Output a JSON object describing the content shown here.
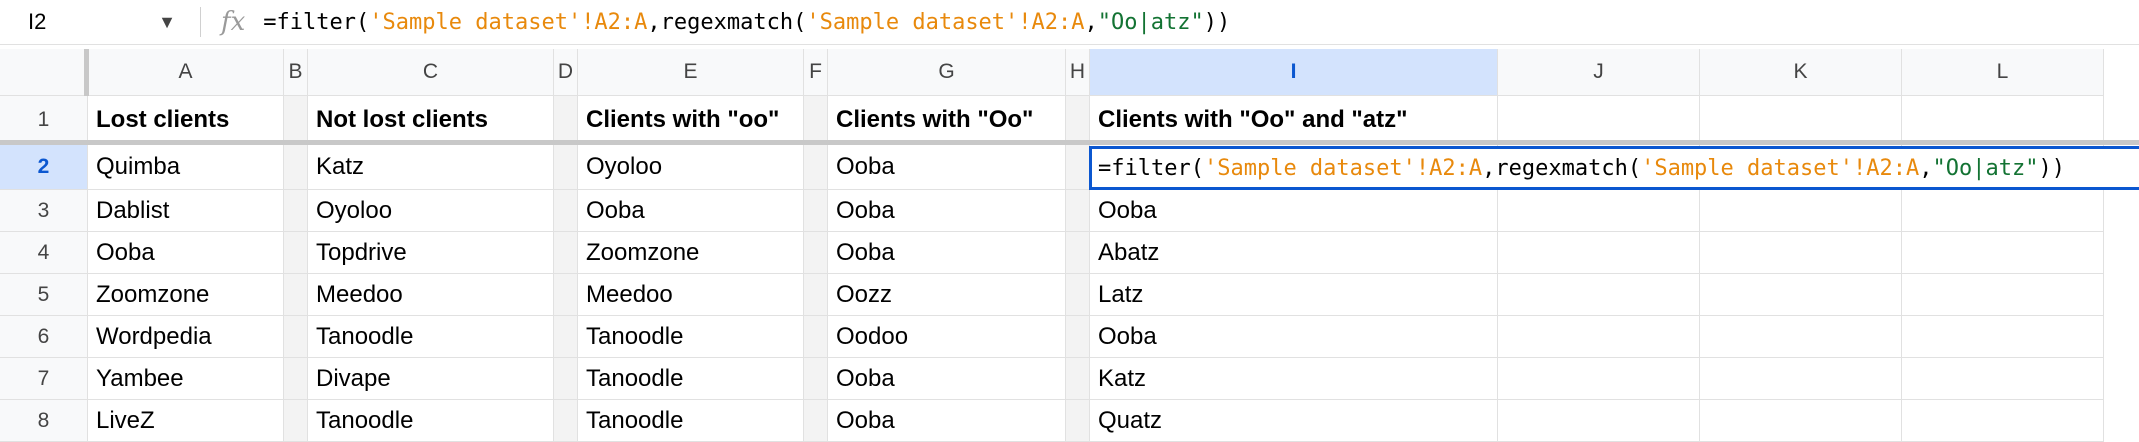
{
  "name_box": "I2",
  "formula": {
    "prefix": "=filter(",
    "range1": "'Sample dataset'!A2:A",
    "mid": ",regexmatch(",
    "range2": "'Sample dataset'!A2:A",
    "comma": ",",
    "pattern": "\"Oo|atz\"",
    "suffix": "))"
  },
  "columns": [
    "A",
    "B",
    "C",
    "D",
    "E",
    "F",
    "G",
    "H",
    "I",
    "J",
    "K",
    "L"
  ],
  "rows": [
    "1",
    "2",
    "3",
    "4",
    "5",
    "6",
    "7",
    "8"
  ],
  "headers": {
    "A": "Lost clients",
    "C": "Not lost clients",
    "E": "Clients with \"oo\"",
    "G": "Clients with \"Oo\"",
    "I": "Clients with \"Oo\" and \"atz\""
  },
  "data": {
    "A": [
      "Quimba",
      "Dablist",
      "Ooba",
      "Zoomzone",
      "Wordpedia",
      "Yambee",
      "LiveZ"
    ],
    "C": [
      "Katz",
      "Oyoloo",
      "Topdrive",
      "Meedoo",
      "Tanoodle",
      "Divape",
      "Tanoodle"
    ],
    "E": [
      "Oyoloo",
      "Ooba",
      "Zoomzone",
      "Meedoo",
      "Tanoodle",
      "Tanoodle",
      "Tanoodle"
    ],
    "G": [
      "Ooba",
      "Ooba",
      "Ooba",
      "Oozz",
      "Oodoo",
      "Ooba",
      "Ooba"
    ],
    "I": [
      "",
      "Ooba",
      "Abatz",
      "Latz",
      "Ooba",
      "Katz",
      "Quatz"
    ]
  }
}
